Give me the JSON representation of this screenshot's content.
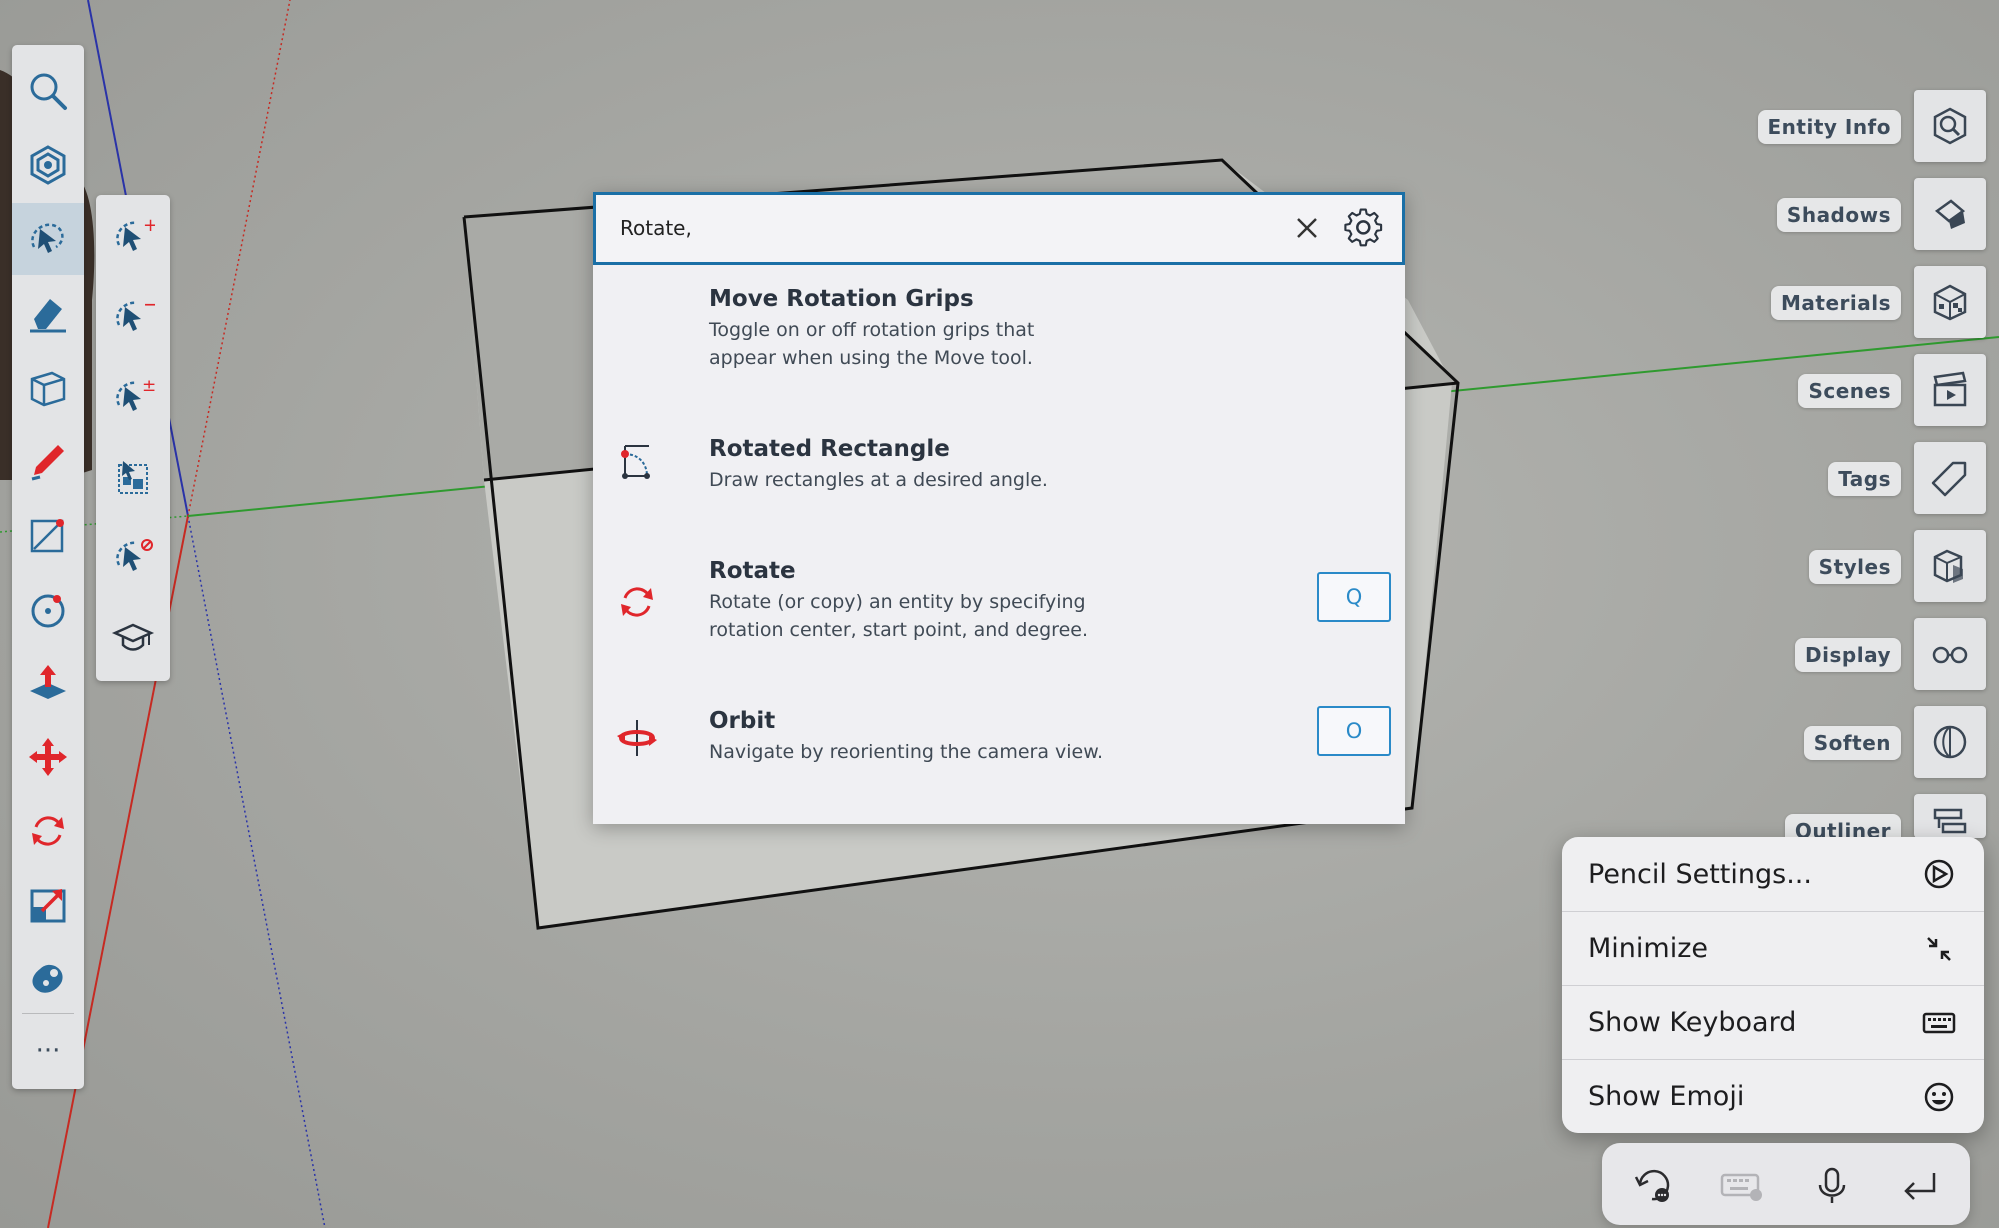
{
  "search": {
    "query": "Rotate,",
    "placeholder": ""
  },
  "results": [
    {
      "title": "Move Rotation Grips",
      "description": "Toggle on or off rotation grips that\nappear when using the Move tool.",
      "icon": "none",
      "shortcut": ""
    },
    {
      "title": "Rotated Rectangle",
      "description": "Draw rectangles at a desired angle.",
      "icon": "rotated-rectangle-icon",
      "shortcut": ""
    },
    {
      "title": "Rotate",
      "description": "Rotate (or copy) an entity by specifying\nrotation center, start point, and degree.",
      "icon": "rotate-icon",
      "shortcut": "Q"
    },
    {
      "title": "Orbit",
      "description": "Navigate by reorienting the camera view.",
      "icon": "orbit-icon",
      "shortcut": "O"
    }
  ],
  "right_panel": {
    "items": [
      {
        "label": "Entity Info",
        "icon": "entity-info-icon"
      },
      {
        "label": "Shadows",
        "icon": "shadows-icon"
      },
      {
        "label": "Materials",
        "icon": "materials-icon"
      },
      {
        "label": "Scenes",
        "icon": "scenes-icon"
      },
      {
        "label": "Tags",
        "icon": "tags-icon"
      },
      {
        "label": "Styles",
        "icon": "styles-icon"
      },
      {
        "label": "Display",
        "icon": "display-icon"
      },
      {
        "label": "Soften",
        "icon": "soften-icon"
      },
      {
        "label": "Outliner",
        "icon": "outliner-icon"
      }
    ]
  },
  "context_menu": {
    "items": [
      {
        "label": "Pencil Settings...",
        "icon": "pencil-settings-icon"
      },
      {
        "label": "Minimize",
        "icon": "minimize-icon"
      },
      {
        "label": "Show Keyboard",
        "icon": "keyboard-icon"
      },
      {
        "label": "Show Emoji",
        "icon": "emoji-icon"
      }
    ]
  },
  "toolbar": {
    "more_label": "···"
  },
  "colors": {
    "accent": "#1a6fa6",
    "tool_red": "#e0262b",
    "tool_blue": "#2b6b9a",
    "axis_red": "#c62a22",
    "axis_green": "#2f9a2f",
    "axis_blue": "#2a33a8"
  }
}
